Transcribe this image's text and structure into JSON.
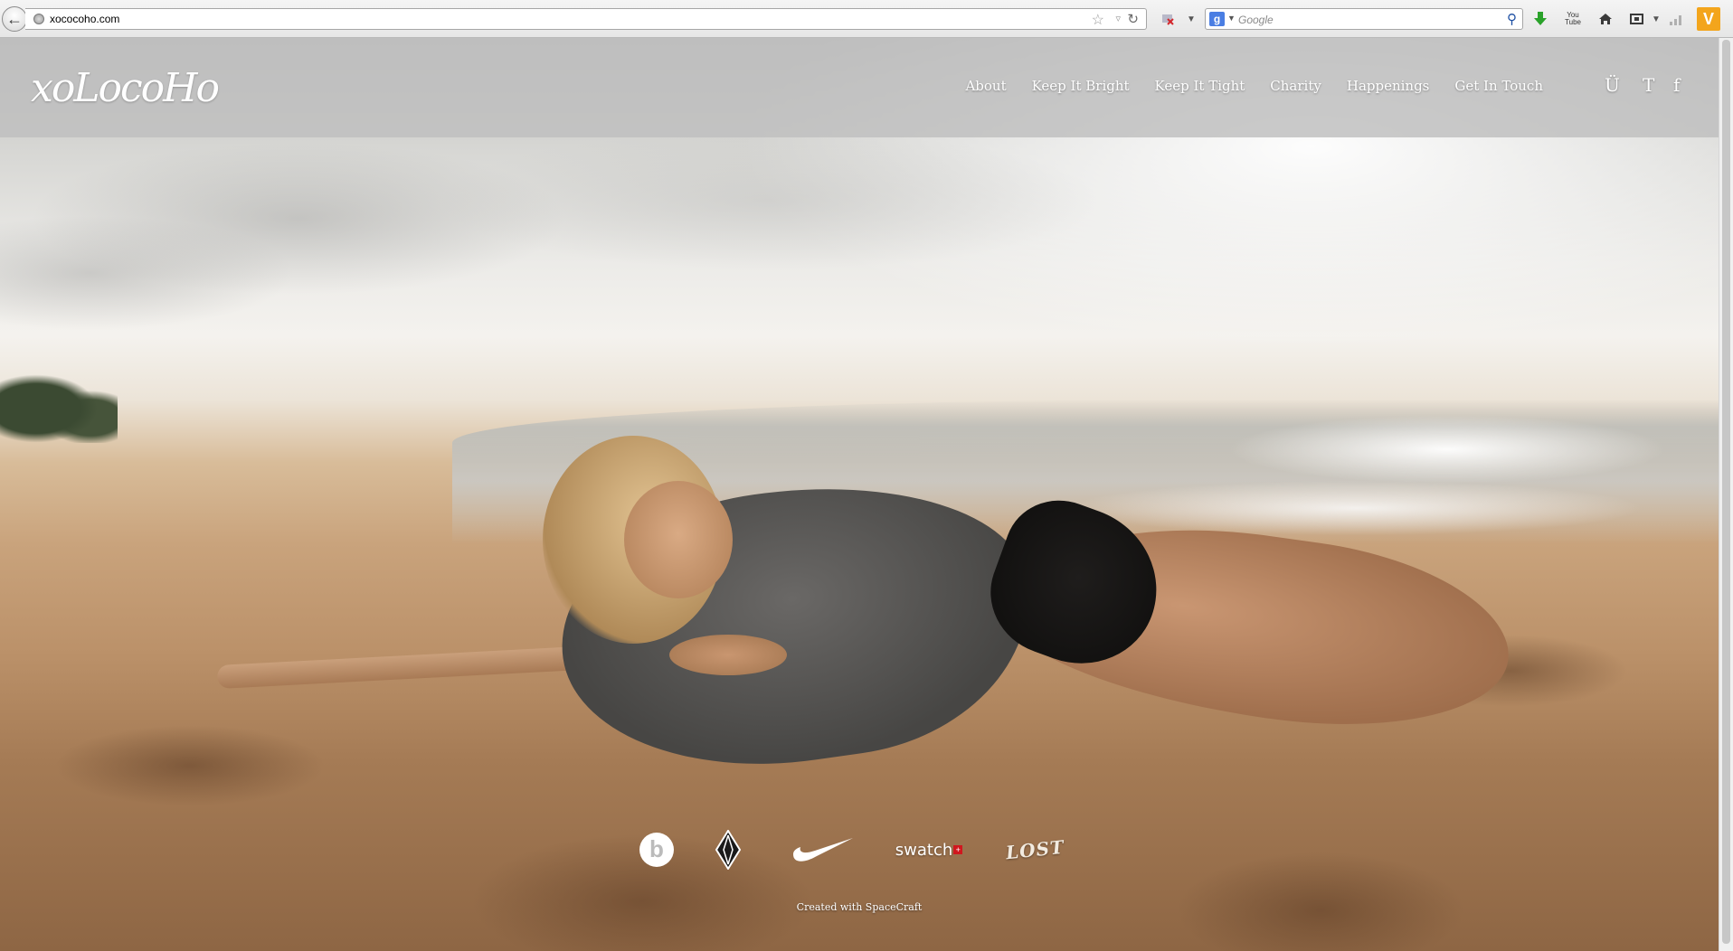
{
  "browser": {
    "url": "xococoho.com",
    "search_placeholder": "Google",
    "search_engine_label": "g",
    "icons": [
      "back-icon",
      "globe-icon",
      "bookmark-star-icon",
      "dropdown-icon",
      "reload-icon",
      "addon-icon",
      "download-icon",
      "youtube-icon",
      "home-icon",
      "screenshot-icon",
      "signal-icon",
      "vivaldi-v-icon"
    ],
    "youtube_label": "You\nTube",
    "vivaldi_label": "V"
  },
  "site": {
    "logo_text": "xoLocoHo",
    "nav": [
      "About",
      "Keep It Bright",
      "Keep It Tight",
      "Charity",
      "Happenings",
      "Get In Touch"
    ],
    "social": [
      "Ü",
      "T",
      "f"
    ],
    "sponsors": {
      "beats": "b",
      "swatch": "swatch",
      "swatch_mark": "+",
      "lost": "LOST"
    },
    "credit": "Created with SpaceCraft"
  },
  "colors": {
    "header_overlay": "#bebebe",
    "nav_text": "#ffffff",
    "sand": "#c9a37c",
    "sweater": "#4f4e4c"
  }
}
